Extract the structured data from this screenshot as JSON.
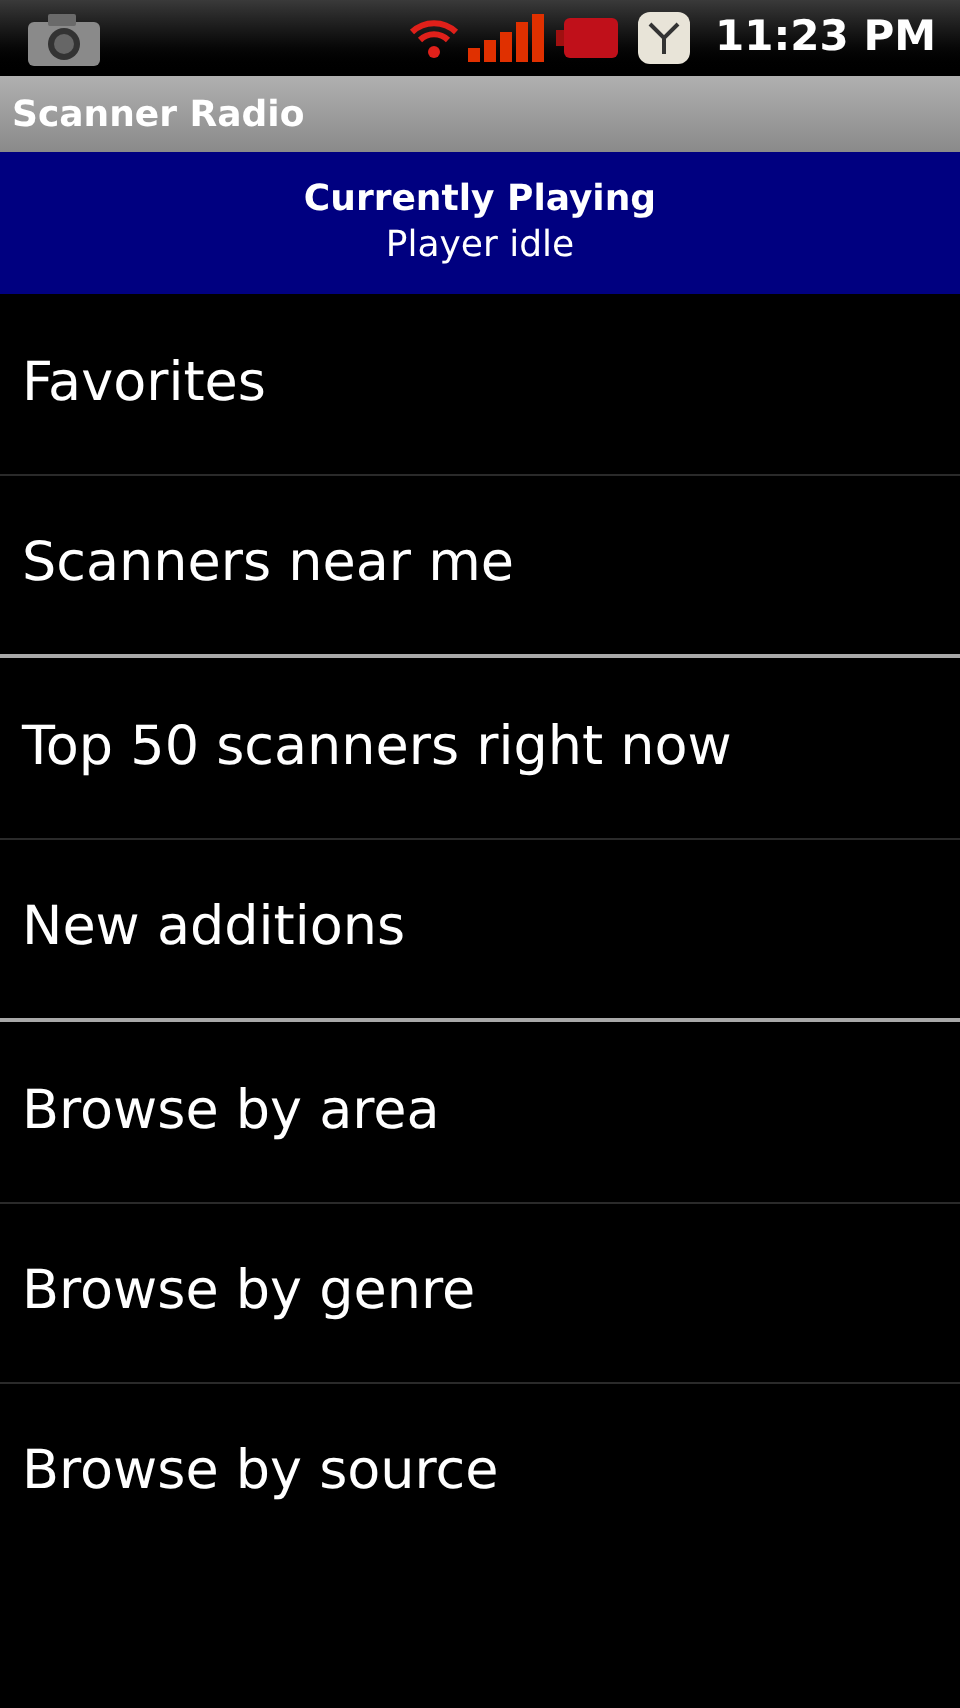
{
  "status_bar": {
    "time": "11:23 PM"
  },
  "title_bar": {
    "title": "Scanner Radio"
  },
  "now_playing": {
    "heading": "Currently Playing",
    "status": "Player idle"
  },
  "menu_sections": [
    {
      "items": [
        "Favorites",
        "Scanners near me"
      ]
    },
    {
      "items": [
        "Top 50 scanners right now",
        "New additions"
      ]
    },
    {
      "items": [
        "Browse by area",
        "Browse by genre",
        "Browse by source"
      ]
    }
  ]
}
